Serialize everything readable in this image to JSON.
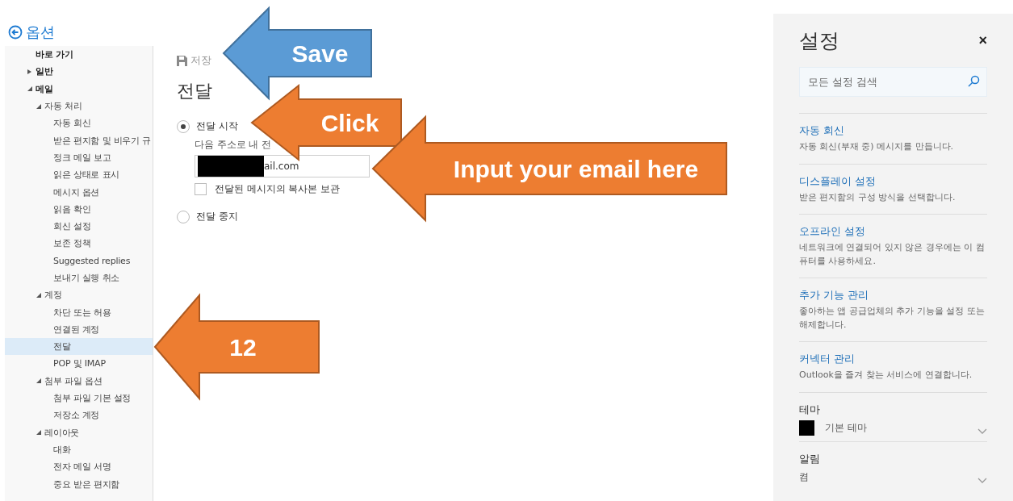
{
  "sidebar": {
    "title": "옵션",
    "items": [
      {
        "label": "바로 가기",
        "selected": false
      },
      {
        "label": "일반",
        "expanded": false,
        "selected": false
      },
      {
        "label": "메일",
        "expanded": true,
        "selected": false,
        "children": [
          {
            "label": "자동 처리",
            "expanded": true,
            "selected": false,
            "children": [
              {
                "label": "자동 회신",
                "selected": false
              },
              {
                "label": "받은 편지함 및 비우기 규",
                "selected": false
              },
              {
                "label": "정크 메일 보고",
                "selected": false
              },
              {
                "label": "읽은 상태로 표시",
                "selected": false
              },
              {
                "label": "메시지 옵션",
                "selected": false
              },
              {
                "label": "읽음 확인",
                "selected": false
              },
              {
                "label": "회신 설정",
                "selected": false
              },
              {
                "label": "보존 정책",
                "selected": false
              },
              {
                "label": "Suggested replies",
                "selected": false
              },
              {
                "label": "보내기 실행 취소",
                "selected": false
              }
            ]
          },
          {
            "label": "계정",
            "expanded": true,
            "selected": false,
            "children": [
              {
                "label": "차단 또는 허용",
                "selected": false
              },
              {
                "label": "연결된 계정",
                "selected": false
              },
              {
                "label": "전달",
                "selected": true
              },
              {
                "label": "POP 및 IMAP",
                "selected": false
              }
            ]
          },
          {
            "label": "첨부 파일 옵션",
            "expanded": true,
            "selected": false,
            "children": [
              {
                "label": "첨부 파일 기본 설정",
                "selected": false
              },
              {
                "label": "저장소 계정",
                "selected": false
              }
            ]
          },
          {
            "label": "레이아웃",
            "expanded": true,
            "selected": false,
            "children": [
              {
                "label": "대화",
                "selected": false
              },
              {
                "label": "전자 메일 서명",
                "selected": false
              },
              {
                "label": "중요 받은 편지함",
                "selected": false
              }
            ]
          }
        ]
      }
    ]
  },
  "main": {
    "save_label": "저장",
    "heading": "전달",
    "options": [
      {
        "label": "전달 시작",
        "selected": true
      },
      {
        "label": "전달 중지",
        "selected": false
      }
    ],
    "address_label": "다음 주소로 내 전",
    "address_value": "ail.com",
    "keep_copy": {
      "label": "전달된 메시지의 복사본 보관",
      "checked": false
    }
  },
  "settings": {
    "title": "설정",
    "close": "×",
    "search": {
      "placeholder": "모든 설정 검색"
    },
    "links": [
      {
        "title": "자동 회신",
        "description": "자동 회신(부재 중) 메시지를 만듭니다."
      },
      {
        "title": "디스플레이 설정",
        "description": "받은 편지함의 구성 방식을 선택합니다."
      },
      {
        "title": "오프라인 설정",
        "description": "네트워크에 연결되어 있지 않은 경우에는 이 컴퓨터를 사용하세요."
      },
      {
        "title": "추가 기능 관리",
        "description": "좋아하는 앱 공급업체의 추가 기능을 설정 또는 해제합니다."
      },
      {
        "title": "커넥터 관리",
        "description": "Outlook을 즐겨 찾는 서비스에 연결합니다."
      }
    ],
    "dropdowns": [
      {
        "kind": "swatch",
        "label": "테마",
        "value": "기본 테마",
        "color": "#000000"
      },
      {
        "kind": "plain",
        "label": "알림",
        "value": "켬"
      }
    ]
  },
  "callouts": [
    {
      "text": "Save",
      "color": "#5b9bd5"
    },
    {
      "text": "Click",
      "color": "#ed7d31"
    },
    {
      "text": "Input your email here",
      "color": "#ed7d31"
    },
    {
      "text": "12",
      "color": "#ed7d31"
    }
  ]
}
